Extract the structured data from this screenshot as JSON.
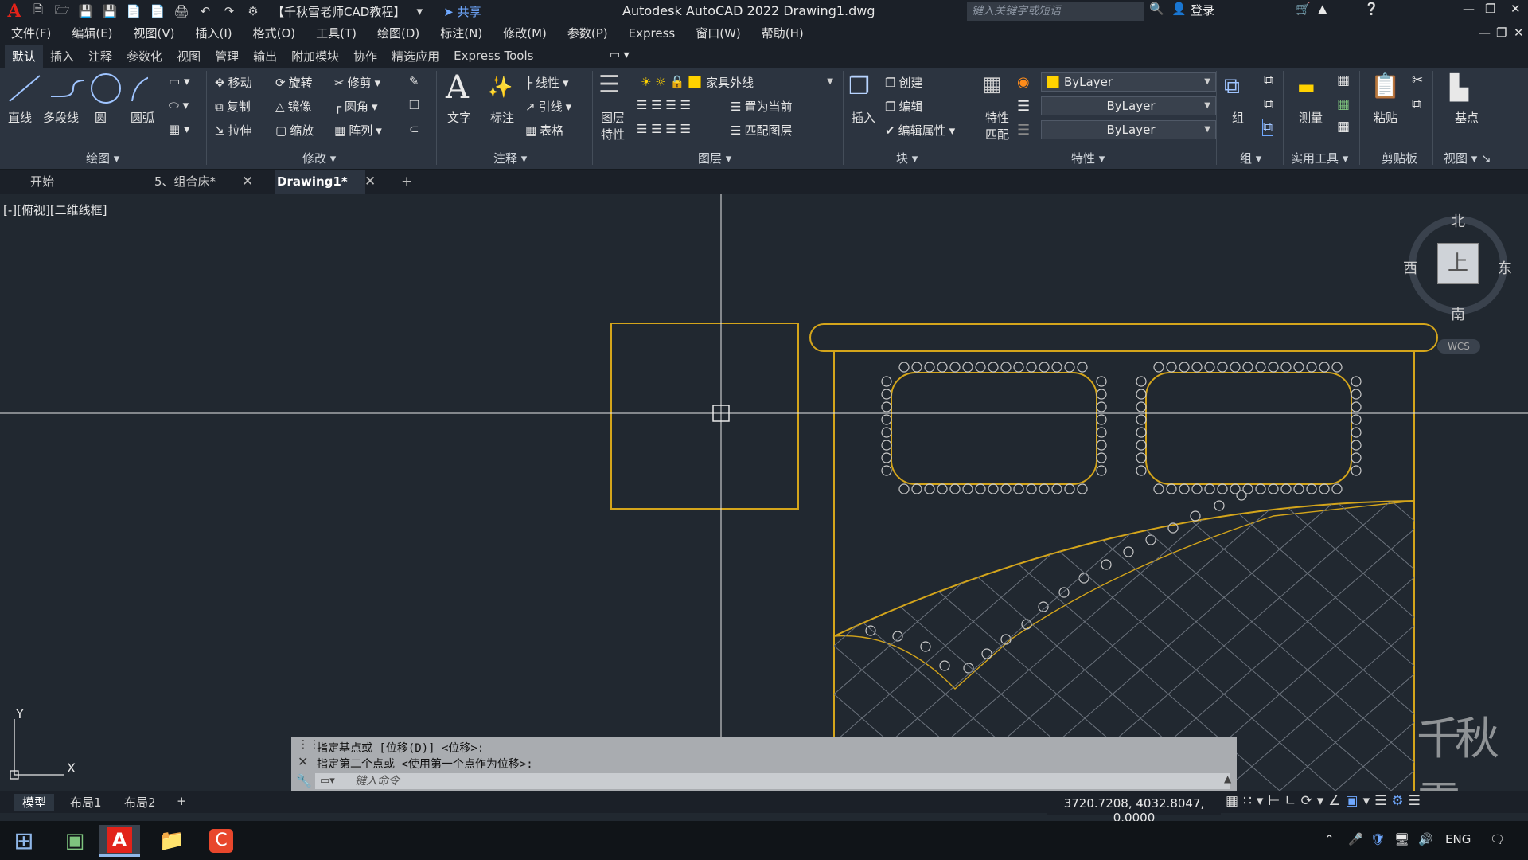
{
  "titlebar": {
    "workspace": "【千秋雪老师CAD教程】",
    "share": "共享",
    "app_title": "Autodesk AutoCAD 2022    Drawing1.dwg",
    "search_placeholder": "键入关键字或短语",
    "login": "登录"
  },
  "menu": {
    "items": [
      "文件(F)",
      "编辑(E)",
      "视图(V)",
      "插入(I)",
      "格式(O)",
      "工具(T)",
      "绘图(D)",
      "标注(N)",
      "修改(M)",
      "参数(P)",
      "Express",
      "窗口(W)",
      "帮助(H)"
    ]
  },
  "ribbon_tabs": [
    "默认",
    "插入",
    "注释",
    "参数化",
    "视图",
    "管理",
    "输出",
    "附加模块",
    "协作",
    "精选应用",
    "Express Tools"
  ],
  "ribbon": {
    "draw": {
      "title": "绘图",
      "line": "直线",
      "polyline": "多段线",
      "circle": "圆",
      "arc": "圆弧"
    },
    "modify": {
      "title": "修改",
      "move": "移动",
      "rotate": "旋转",
      "trim": "修剪",
      "copy": "复制",
      "mirror": "镜像",
      "fillet": "圆角",
      "stretch": "拉伸",
      "scale": "缩放",
      "array": "阵列"
    },
    "annotation": {
      "title": "注释",
      "text": "文字",
      "dimension": "标注",
      "linear": "线性",
      "leader": "引线",
      "table": "表格"
    },
    "layers": {
      "title": "图层",
      "layer_props_1": "图层",
      "layer_props_2": "特性",
      "current_layer": "家具外线",
      "set_current": "置为当前",
      "match_layer": "匹配图层"
    },
    "block": {
      "title": "块",
      "insert": "插入",
      "create": "创建",
      "edit": "编辑",
      "edit_attr": "编辑属性"
    },
    "properties": {
      "title": "特性",
      "match_1": "特性",
      "match_2": "匹配",
      "color": "ByLayer",
      "linetype": "ByLayer",
      "lineweight": "ByLayer"
    },
    "group": {
      "title": "组",
      "label": "组"
    },
    "utilities": {
      "title": "实用工具",
      "measure": "测量"
    },
    "clipboard": {
      "title": "剪贴板",
      "paste": "粘贴"
    },
    "view": {
      "title": "视图",
      "base": "基点"
    }
  },
  "doc_tabs": {
    "start": "开始",
    "tab1": "5、组合床*",
    "tab2": "Drawing1*"
  },
  "viewport": {
    "label": "[-][俯视][二维线框]",
    "compass": {
      "north": "北",
      "south": "南",
      "east": "东",
      "west": "西",
      "top": "上",
      "wcs": "WCS"
    },
    "ucs": {
      "x": "X",
      "y": "Y"
    }
  },
  "command": {
    "line1": "指定基点或 [位移(D)] <位移>:",
    "line2": "指定第二个点或 <使用第一个点作为位移>:",
    "placeholder": "键入命令"
  },
  "layout_tabs": [
    "模型",
    "布局1",
    "布局2"
  ],
  "status": {
    "coords": "3720.7208, 4032.8047, 0.0000"
  },
  "taskbar": {
    "lang": "ENG"
  },
  "watermark": "千秋雪",
  "colors": {
    "cad_yellow": "#d4a51b",
    "canvas_bg": "#212830",
    "panel_bg": "#2c3440"
  }
}
